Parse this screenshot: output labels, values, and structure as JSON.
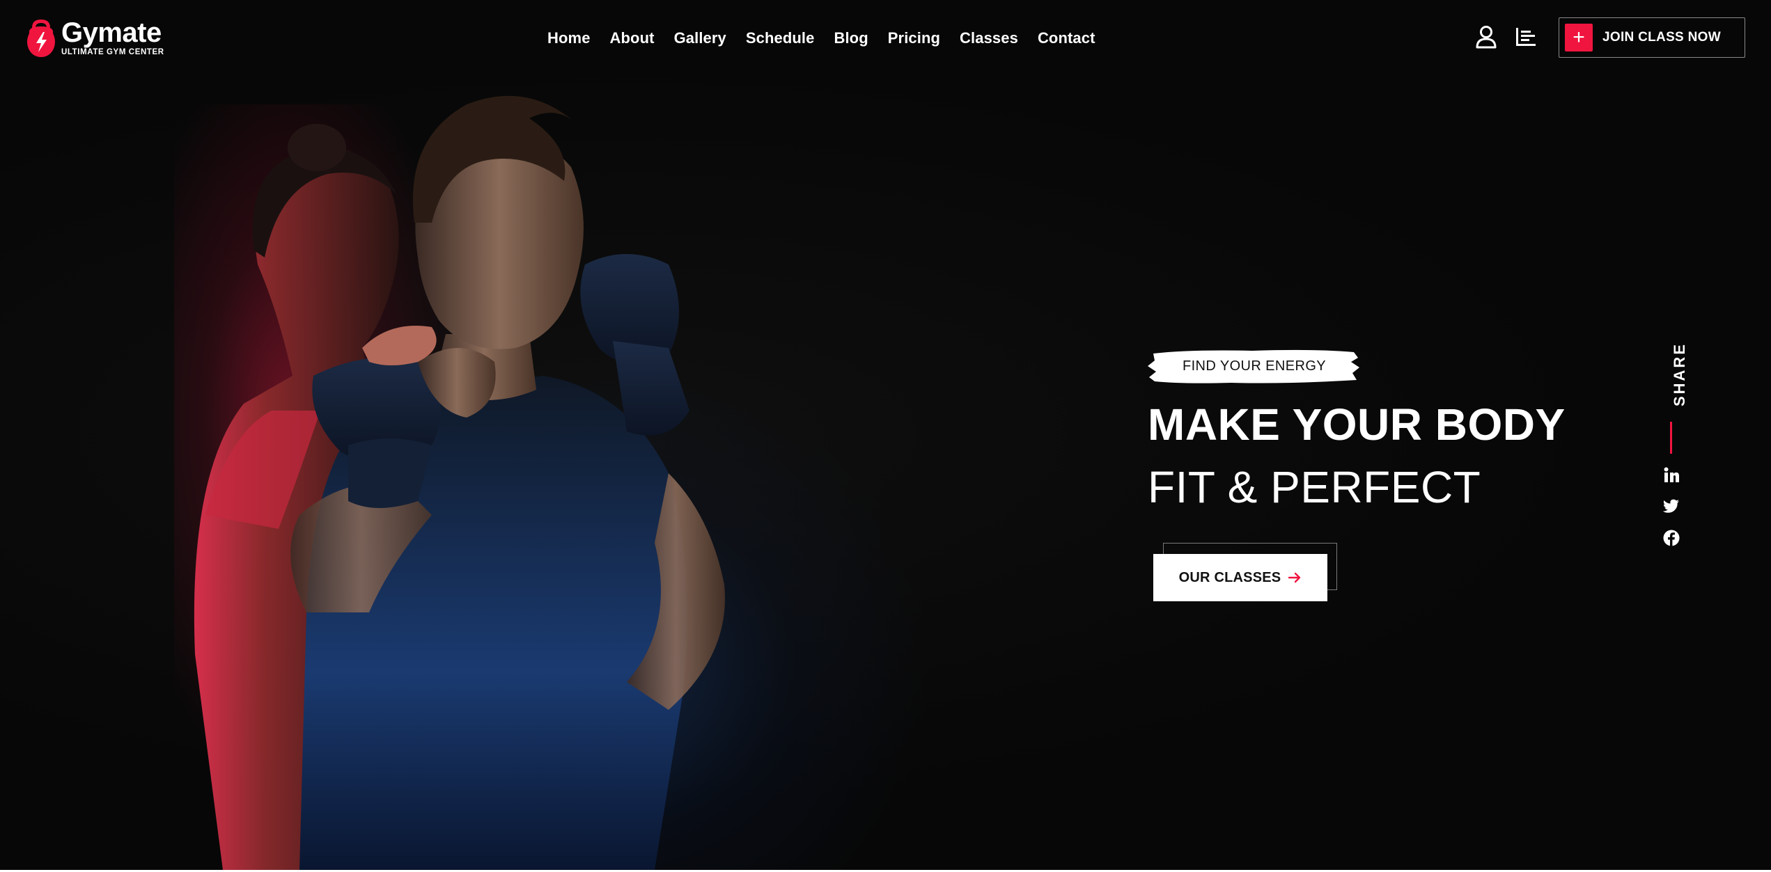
{
  "brand": {
    "name": "Gymate",
    "tagline": "ULTIMATE GYM CENTER",
    "accent_color": "#f0153f"
  },
  "nav": {
    "items": [
      {
        "label": "Home"
      },
      {
        "label": "About"
      },
      {
        "label": "Gallery"
      },
      {
        "label": "Schedule"
      },
      {
        "label": "Blog"
      },
      {
        "label": "Pricing"
      },
      {
        "label": "Classes"
      },
      {
        "label": "Contact"
      }
    ]
  },
  "header_actions": {
    "user_icon": "user-icon",
    "menu_icon": "bar-menu-icon",
    "join_button": {
      "icon": "plus-icon",
      "label": "JOIN CLASS NOW"
    }
  },
  "hero": {
    "tagline": "FIND YOUR ENERGY",
    "headline_line1": "MAKE YOUR BODY",
    "headline_line2": "FIT & PERFECT",
    "cta": {
      "label": "OUR CLASSES",
      "icon": "arrow-right-icon"
    }
  },
  "share": {
    "label": "SHARE",
    "icons": [
      "linkedin-icon",
      "twitter-icon",
      "facebook-icon"
    ]
  }
}
